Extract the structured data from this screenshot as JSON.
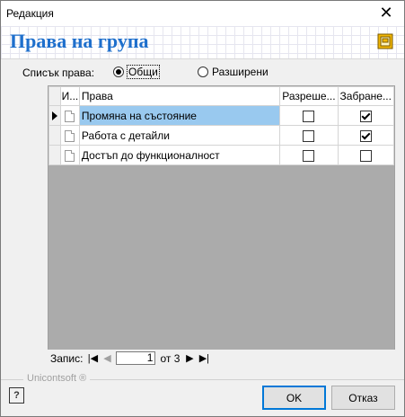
{
  "window": {
    "title": "Редакция",
    "close_glyph": "✕"
  },
  "header": {
    "title": "Права на група",
    "icon": "document-frame-icon"
  },
  "list_type": {
    "label": "Списък права:",
    "options": [
      {
        "label": "Общи",
        "selected": true
      },
      {
        "label": "Разширени",
        "selected": false
      }
    ]
  },
  "grid": {
    "columns": {
      "icon": "И...",
      "name": "Права",
      "allow": "Разреше...",
      "deny": "Забране..."
    },
    "rows": [
      {
        "name": "Промяна на състояние",
        "allow": false,
        "deny": true,
        "current": true
      },
      {
        "name": "Работа с детайли",
        "allow": false,
        "deny": true,
        "current": false
      },
      {
        "name": "Достъп до функционалност",
        "allow": false,
        "deny": false,
        "current": false
      }
    ]
  },
  "navigator": {
    "label": "Запис:",
    "record": "1",
    "of_text": "от 3"
  },
  "brand": "Unicontsoft ®",
  "buttons": {
    "ok": "OK",
    "cancel": "Отказ",
    "help_glyph": "?"
  }
}
